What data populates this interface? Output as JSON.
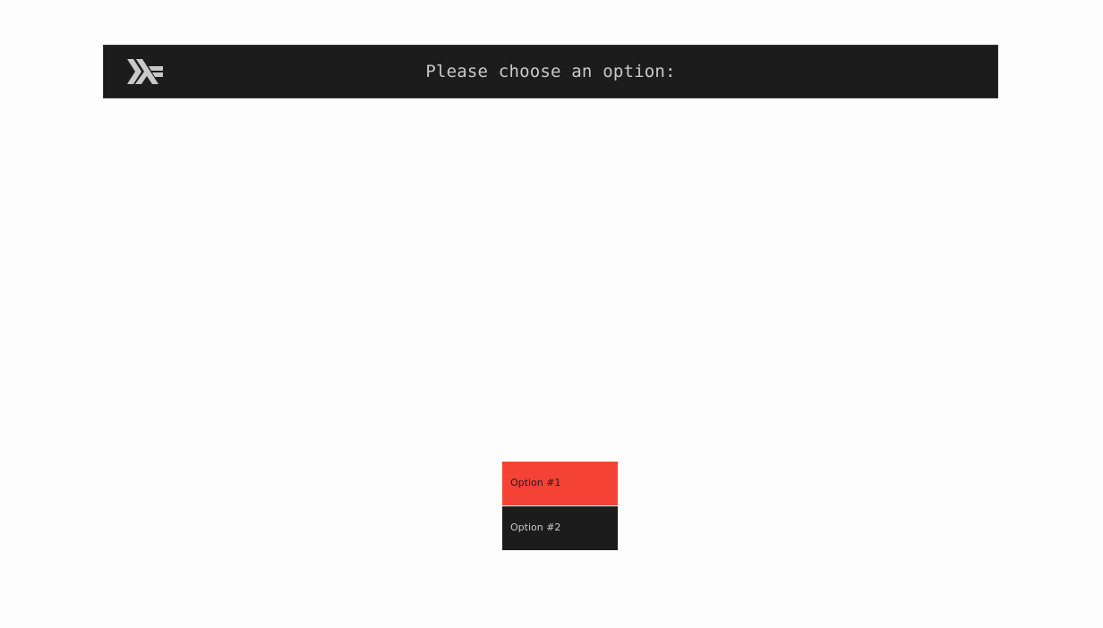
{
  "header": {
    "logo_icon": "haskell-logo-icon",
    "title": "Please choose an option:",
    "background": "#1c1c1c",
    "text_color": "#c9c9c9"
  },
  "menu": {
    "options": [
      {
        "label": "Option #1",
        "selected": true,
        "background": "#f44336",
        "text_color": "#1c1c1c"
      },
      {
        "label": "Option #2",
        "selected": false,
        "background": "#1c1c1c",
        "text_color": "#c9c9c9"
      }
    ]
  }
}
